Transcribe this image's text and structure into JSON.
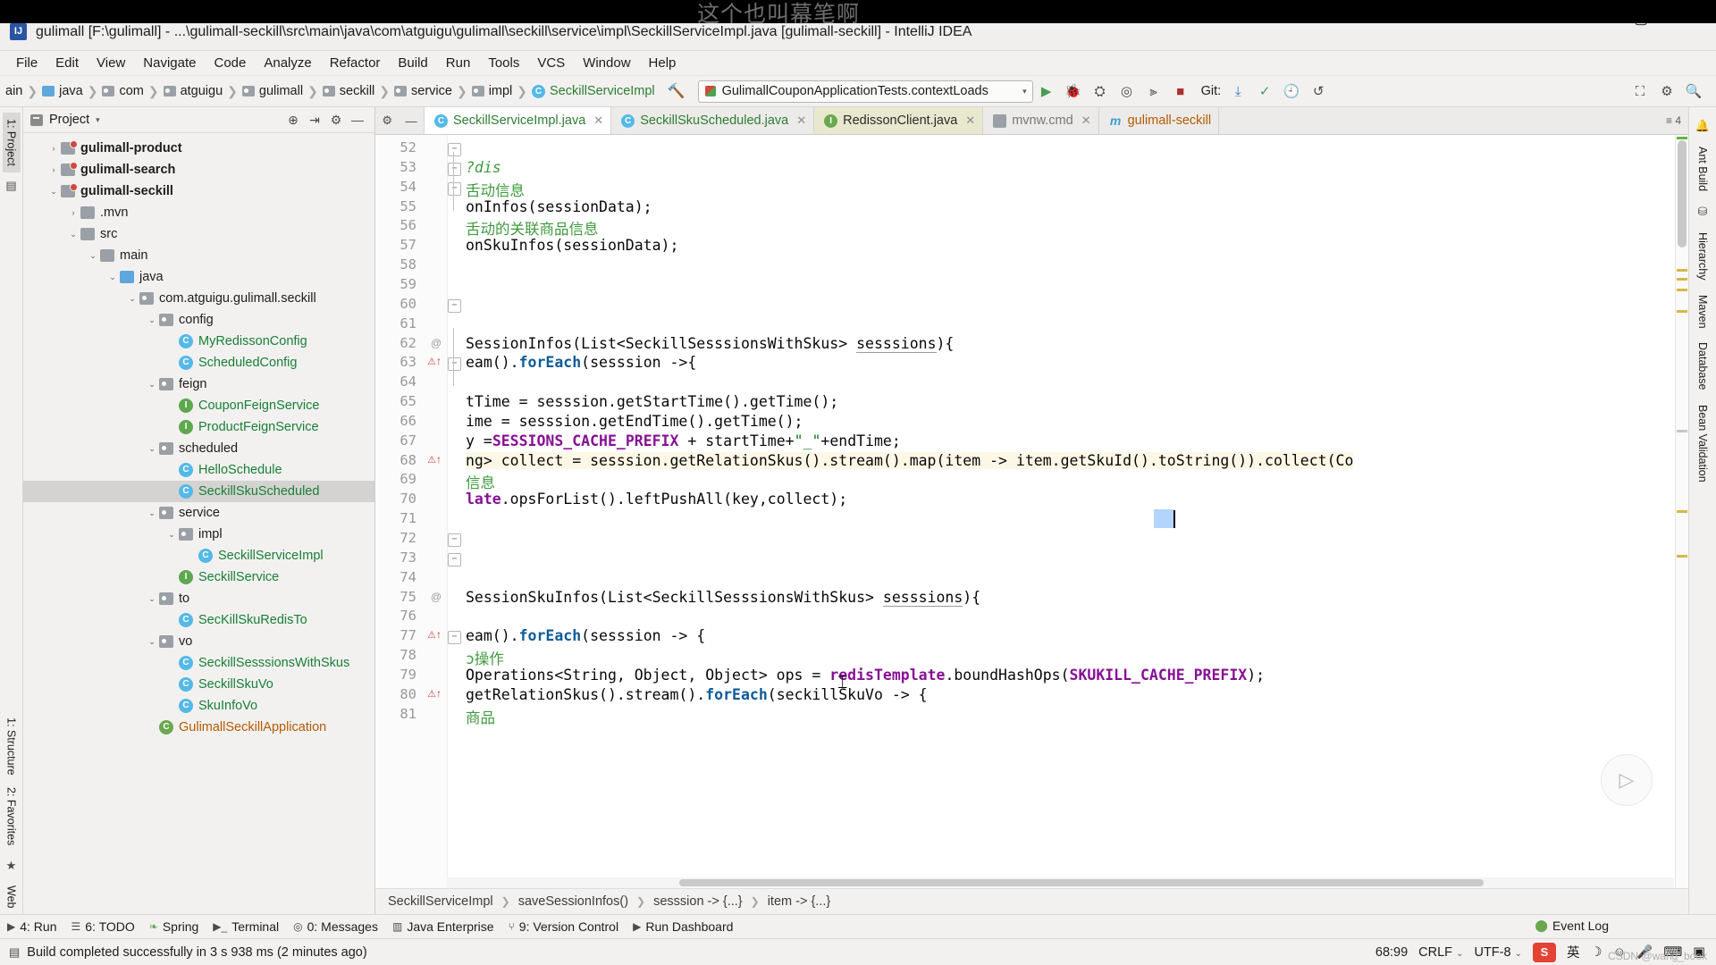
{
  "watermark": "这个也叫幕笔啊",
  "bottom_watermark": "CSDN @wang_book",
  "titlebar": {
    "app_icon": "intellij-idea-icon",
    "title": "gulimall [F:\\gulimall] - ...\\gulimall-seckill\\src\\main\\java\\com\\atguigu\\gulimall\\seckill\\service\\impl\\SeckillServiceImpl.java [gulimall-seckill] - IntelliJ IDEA",
    "minimize": "—",
    "maximize": "▢",
    "close": "✕"
  },
  "menubar": [
    "File",
    "Edit",
    "View",
    "Navigate",
    "Code",
    "Analyze",
    "Refactor",
    "Build",
    "Run",
    "Tools",
    "VCS",
    "Window",
    "Help"
  ],
  "toolbar": {
    "breadcrumbs": [
      {
        "label": "ain",
        "icon": "none"
      },
      {
        "label": "java",
        "icon": "folder-blue-icon"
      },
      {
        "label": "com",
        "icon": "package-icon"
      },
      {
        "label": "atguigu",
        "icon": "package-icon"
      },
      {
        "label": "gulimall",
        "icon": "package-icon"
      },
      {
        "label": "seckill",
        "icon": "package-icon"
      },
      {
        "label": "service",
        "icon": "package-icon"
      },
      {
        "label": "impl",
        "icon": "package-icon"
      },
      {
        "label": "SeckillServiceImpl",
        "icon": "class-icon"
      }
    ],
    "build_icon": "hammer-icon",
    "run_config": "GulimallCouponApplicationTests.contextLoads",
    "run_config_dropdown": "▾",
    "actions": [
      "run-icon",
      "debug-icon",
      "run-coverage-icon",
      "profile-icon",
      "stop-icon",
      "build-icon"
    ],
    "git_label": "Git:",
    "git_actions": [
      "update-project-icon",
      "commit-icon",
      "history-icon",
      "rollback-icon"
    ],
    "right_actions": [
      "select-in-icon",
      "settings-icon",
      "search-everywhere-icon"
    ]
  },
  "project_panel": {
    "title": "Project",
    "title_arrow": "▾",
    "header_icons": [
      "locate-icon",
      "collapse-all-icon",
      "settings-icon",
      "hide-icon"
    ],
    "tree": [
      {
        "indent": 1,
        "arrow": "›",
        "icon": "module-icon",
        "label": "gulimall-product",
        "bold": true,
        "color": "default"
      },
      {
        "indent": 1,
        "arrow": "›",
        "icon": "module-icon",
        "label": "gulimall-search",
        "bold": true,
        "color": "default"
      },
      {
        "indent": 1,
        "arrow": "⌄",
        "icon": "module-icon",
        "label": "gulimall-seckill",
        "bold": true,
        "color": "default"
      },
      {
        "indent": 2,
        "arrow": "›",
        "icon": "folder-gray-icon",
        "label": ".mvn",
        "bold": false,
        "color": "default"
      },
      {
        "indent": 2,
        "arrow": "⌄",
        "icon": "folder-gray-icon",
        "label": "src",
        "bold": false,
        "color": "default"
      },
      {
        "indent": 3,
        "arrow": "⌄",
        "icon": "folder-gray-icon",
        "label": "main",
        "bold": false,
        "color": "default"
      },
      {
        "indent": 4,
        "arrow": "⌄",
        "icon": "folder-blue-icon",
        "label": "java",
        "bold": false,
        "color": "default"
      },
      {
        "indent": 5,
        "arrow": "⌄",
        "icon": "package-icon",
        "label": "com.atguigu.gulimall.seckill",
        "bold": false,
        "color": "default"
      },
      {
        "indent": 6,
        "arrow": "⌄",
        "icon": "package-icon",
        "label": "config",
        "bold": false,
        "color": "default"
      },
      {
        "indent": 7,
        "arrow": "",
        "icon": "class-icon",
        "label": "MyRedissonConfig",
        "bold": false,
        "color": "green"
      },
      {
        "indent": 7,
        "arrow": "",
        "icon": "class-icon",
        "label": "ScheduledConfig",
        "bold": false,
        "color": "green"
      },
      {
        "indent": 6,
        "arrow": "⌄",
        "icon": "package-icon",
        "label": "feign",
        "bold": false,
        "color": "default"
      },
      {
        "indent": 7,
        "arrow": "",
        "icon": "interface-icon",
        "label": "CouponFeignService",
        "bold": false,
        "color": "green"
      },
      {
        "indent": 7,
        "arrow": "",
        "icon": "interface-icon",
        "label": "ProductFeignService",
        "bold": false,
        "color": "green"
      },
      {
        "indent": 6,
        "arrow": "⌄",
        "icon": "package-icon",
        "label": "scheduled",
        "bold": false,
        "color": "default"
      },
      {
        "indent": 7,
        "arrow": "",
        "icon": "class-icon",
        "label": "HelloSchedule",
        "bold": false,
        "color": "green"
      },
      {
        "indent": 7,
        "arrow": "",
        "icon": "class-icon",
        "label": "SeckillSkuScheduled",
        "bold": false,
        "color": "green",
        "selected": true
      },
      {
        "indent": 6,
        "arrow": "⌄",
        "icon": "package-icon",
        "label": "service",
        "bold": false,
        "color": "default"
      },
      {
        "indent": 7,
        "arrow": "⌄",
        "icon": "package-icon",
        "label": "impl",
        "bold": false,
        "color": "default"
      },
      {
        "indent": 8,
        "arrow": "",
        "icon": "class-icon",
        "label": "SeckillServiceImpl",
        "bold": false,
        "color": "green"
      },
      {
        "indent": 7,
        "arrow": "",
        "icon": "interface-icon",
        "label": "SeckillService",
        "bold": false,
        "color": "green"
      },
      {
        "indent": 6,
        "arrow": "⌄",
        "icon": "package-icon",
        "label": "to",
        "bold": false,
        "color": "default"
      },
      {
        "indent": 7,
        "arrow": "",
        "icon": "class-icon",
        "label": "SecKillSkuRedisTo",
        "bold": false,
        "color": "green"
      },
      {
        "indent": 6,
        "arrow": "⌄",
        "icon": "package-icon",
        "label": "vo",
        "bold": false,
        "color": "default"
      },
      {
        "indent": 7,
        "arrow": "",
        "icon": "class-icon",
        "label": "SeckillSesssionsWithSkus",
        "bold": false,
        "color": "green"
      },
      {
        "indent": 7,
        "arrow": "",
        "icon": "class-icon",
        "label": "SeckillSkuVo",
        "bold": false,
        "color": "green"
      },
      {
        "indent": 7,
        "arrow": "",
        "icon": "class-icon",
        "label": "SkuInfoVo",
        "bold": false,
        "color": "green"
      },
      {
        "indent": 6,
        "arrow": "",
        "icon": "app-icon",
        "label": "GulimallSeckillApplication",
        "bold": false,
        "color": "orange"
      }
    ]
  },
  "left_rail": {
    "top": [
      "1: Project"
    ],
    "bottom": [
      "1: Structure",
      "2: Favorites",
      "Web"
    ]
  },
  "right_rail": [
    "Ant Build",
    "Hierarchy",
    "Maven",
    "Database",
    "Bean Validation"
  ],
  "editor": {
    "tab_lead_icons": [
      "settings-icon",
      "minimize-icon"
    ],
    "tabs": [
      {
        "label": "SeckillServiceImpl.java",
        "icon": "class-icon",
        "state": "active",
        "color": "green"
      },
      {
        "label": "SeckillSkuScheduled.java",
        "icon": "class-icon",
        "state": "normal",
        "color": "green"
      },
      {
        "label": "RedissonClient.java",
        "icon": "interface-icon",
        "state": "highlight",
        "color": "dark"
      },
      {
        "label": "mvnw.cmd",
        "icon": "file-icon",
        "state": "normal",
        "color": "dim"
      },
      {
        "label": "gulimall-seckill",
        "icon": "maven-icon",
        "state": "normal",
        "color": "orange"
      }
    ],
    "tabs_right": [
      "≡ 4"
    ],
    "lines": [
      {
        "n": "52",
        "text": "",
        "fold": "minus",
        "marker": ""
      },
      {
        "n": "53",
        "text": "?dis",
        "fold": "minus",
        "marker": "",
        "style": "comment-italic"
      },
      {
        "n": "54",
        "text": "舌动信息",
        "fold": "minus",
        "marker": "",
        "style": "comment"
      },
      {
        "n": "55",
        "text": "onInfos(sessionData);",
        "fold": "",
        "marker": ""
      },
      {
        "n": "56",
        "text": "舌动的关联商品信息",
        "fold": "",
        "marker": "",
        "style": "comment"
      },
      {
        "n": "57",
        "text": "onSkuInfos(sessionData);",
        "fold": "",
        "marker": ""
      },
      {
        "n": "58",
        "text": "",
        "fold": "",
        "marker": ""
      },
      {
        "n": "59",
        "text": "",
        "fold": "",
        "marker": ""
      },
      {
        "n": "60",
        "text": "",
        "fold": "minus",
        "marker": ""
      },
      {
        "n": "61",
        "text": "",
        "fold": "",
        "marker": ""
      },
      {
        "n": "62",
        "text": "SessionInfos(List<SeckillSesssionsWithSkus> sesssions){",
        "fold": "",
        "marker": "@"
      },
      {
        "n": "63",
        "text": "eam().forEach(sesssion ->{",
        "fold": "minus",
        "marker": "warn"
      },
      {
        "n": "64",
        "text": "",
        "fold": "",
        "marker": ""
      },
      {
        "n": "65",
        "text": "tTime = sesssion.getStartTime().getTime();",
        "fold": "",
        "marker": ""
      },
      {
        "n": "66",
        "text": "ime = sesssion.getEndTime().getTime();",
        "fold": "",
        "marker": ""
      },
      {
        "n": "67",
        "text": "y =SESSIONS_CACHE_PREFIX + startTime+\"_\"+endTime;",
        "fold": "",
        "marker": ""
      },
      {
        "n": "68",
        "text": "ng> collect = sesssion.getRelationSkus().stream().map(item -> item.getSkuId().toString()).collect(Co",
        "fold": "",
        "marker": "warn",
        "current": true
      },
      {
        "n": "69",
        "text": "信息",
        "fold": "",
        "marker": "",
        "style": "comment"
      },
      {
        "n": "70",
        "text": "late.opsForList().leftPushAll(key,collect);",
        "fold": "",
        "marker": ""
      },
      {
        "n": "71",
        "text": "",
        "fold": "",
        "marker": ""
      },
      {
        "n": "72",
        "text": "",
        "fold": "minus",
        "marker": ""
      },
      {
        "n": "73",
        "text": "",
        "fold": "minus",
        "marker": ""
      },
      {
        "n": "74",
        "text": "",
        "fold": "",
        "marker": ""
      },
      {
        "n": "75",
        "text": "SessionSkuInfos(List<SeckillSesssionsWithSkus> sesssions){",
        "fold": "",
        "marker": "@"
      },
      {
        "n": "76",
        "text": "",
        "fold": "",
        "marker": ""
      },
      {
        "n": "77",
        "text": "eam().forEach(sesssion -> {",
        "fold": "minus",
        "marker": "warn"
      },
      {
        "n": "78",
        "text": "ɔ操作",
        "fold": "",
        "marker": "",
        "style": "comment"
      },
      {
        "n": "79",
        "text": "Operations<String, Object, Object> ops = redisTemplate.boundHashOps(SKUKILL_CACHE_PREFIX);",
        "fold": "",
        "marker": ""
      },
      {
        "n": "80",
        "text": "getRelationSkus().stream().forEach(seckillSkuVo -> {",
        "fold": "",
        "marker": "warn"
      },
      {
        "n": "81",
        "text": "商品",
        "fold": "",
        "marker": "",
        "style": "comment"
      }
    ],
    "breadcrumb": [
      "SeckillServiceImpl",
      "saveSessionInfos()",
      "sesssion -> {...}",
      "item -> {...}"
    ]
  },
  "bottom_toolwindows": [
    {
      "icon": "▶",
      "label": "4: Run"
    },
    {
      "icon": "☰",
      "label": "6: TODO"
    },
    {
      "icon": "🍃",
      "label": "Spring"
    },
    {
      "icon": "▶_",
      "label": "Terminal"
    },
    {
      "icon": "◎",
      "label": "0: Messages"
    },
    {
      "icon": "☷",
      "label": "Java Enterprise"
    },
    {
      "icon": "⑂",
      "label": "9: Version Control"
    },
    {
      "icon": "▶",
      "label": "Run Dashboard"
    }
  ],
  "statusbar": {
    "message": "Build completed successfully in 3 s 938 ms (2 minutes ago)",
    "event_log": "Event Log",
    "caret_position": "68:99",
    "line_separator": "CRLF",
    "encoding": "UTF-8",
    "ime": "英",
    "tray_icons": [
      "sogou-icon",
      "moon-icon",
      "smile-icon",
      "mic-icon",
      "keyboard-icon",
      "box-icon"
    ]
  },
  "colors": {
    "accent_green": "#2e7d32",
    "accent_blue": "#54b9e8",
    "highlight_yellow": "#fdf0bc",
    "tab_highlight": "#e8e8cf",
    "panel_bg": "#f2f1f0"
  }
}
